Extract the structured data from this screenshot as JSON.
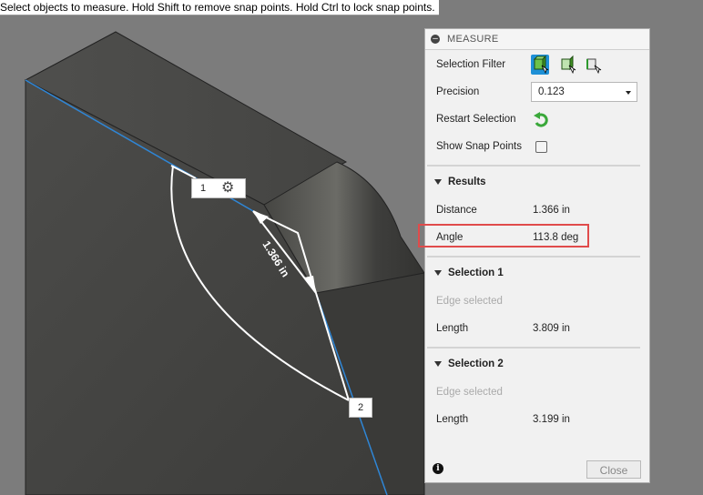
{
  "status_hint": "Select objects to measure. Hold Shift to remove snap points. Hold Ctrl to lock snap points.",
  "viewport": {
    "dimension_label": "1.366 in",
    "point_tag_1": "1",
    "point_tag_2": "2",
    "gear_icon": "gear-icon"
  },
  "panel": {
    "title": "MEASURE",
    "selection_filter_label": "Selection Filter",
    "precision_label": "Precision",
    "precision_value": "0.123",
    "restart_selection_label": "Restart Selection",
    "show_snap_points_label": "Show Snap Points",
    "show_snap_points_checked": false,
    "results": {
      "header": "Results",
      "distance_label": "Distance",
      "distance_value": "1.366 in",
      "angle_label": "Angle",
      "angle_value": "113.8 deg"
    },
    "selection1": {
      "header": "Selection 1",
      "status": "Edge selected",
      "length_label": "Length",
      "length_value": "3.809 in"
    },
    "selection2": {
      "header": "Selection 2",
      "status": "Edge selected",
      "length_label": "Length",
      "length_value": "3.199 in"
    },
    "close_label": "Close"
  },
  "colors": {
    "accent": "#1e90d6",
    "highlight": "#e04b4b",
    "restart_icon": "#3aa83a"
  }
}
